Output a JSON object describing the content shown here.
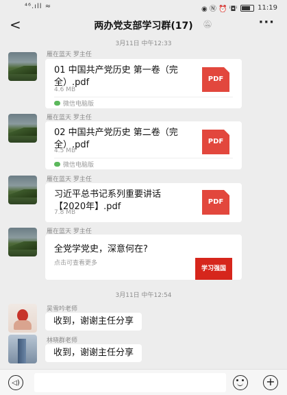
{
  "status_bar": {
    "signal": "⁴⁶.ıll ≈",
    "icons": "◉ Ⓝ ⏰ ⁱ◘ⁱ",
    "time": "11:19"
  },
  "header": {
    "back": "<",
    "title": "两办党支部学习群(17)",
    "mute_icon": "bell-muted-icon",
    "more": "···"
  },
  "timestamps": [
    "3月11日 中午12:33",
    "3月11日 中午12:54"
  ],
  "messages": [
    {
      "sender": "雁在蓝天 罗主任",
      "file_name": "01 中国共产党历史 第一卷（完全）.pdf",
      "size": "4.6 MB",
      "source": "微信电脑版",
      "badge": "PDF"
    },
    {
      "sender": "雁在蓝天 罗主任",
      "file_name": "02 中国共产党历史 第二卷（完全）.pdf",
      "size": "4.5 MB",
      "source": "微信电脑版",
      "badge": "PDF"
    },
    {
      "sender": "雁在蓝天 罗主任",
      "file_name": "习近平总书记系列重要讲话【2020年】.pdf",
      "size": "7.8 MB",
      "badge": "PDF"
    },
    {
      "sender": "雁在蓝天 罗主任",
      "link_title": "全党学党史，深意何在?",
      "link_desc": "点击可查看更多",
      "thumb_text": "学习强国"
    },
    {
      "sender": "吴雪吟老师",
      "text": "收到，谢谢主任分享"
    },
    {
      "sender": "林晓群老师",
      "text": "收到，谢谢主任分享"
    }
  ],
  "input_bar": {
    "voice": "◁)",
    "plus": "+"
  },
  "colors": {
    "background": "#ededed",
    "pdf": "#e2473d",
    "bubble": "#ffffff"
  }
}
